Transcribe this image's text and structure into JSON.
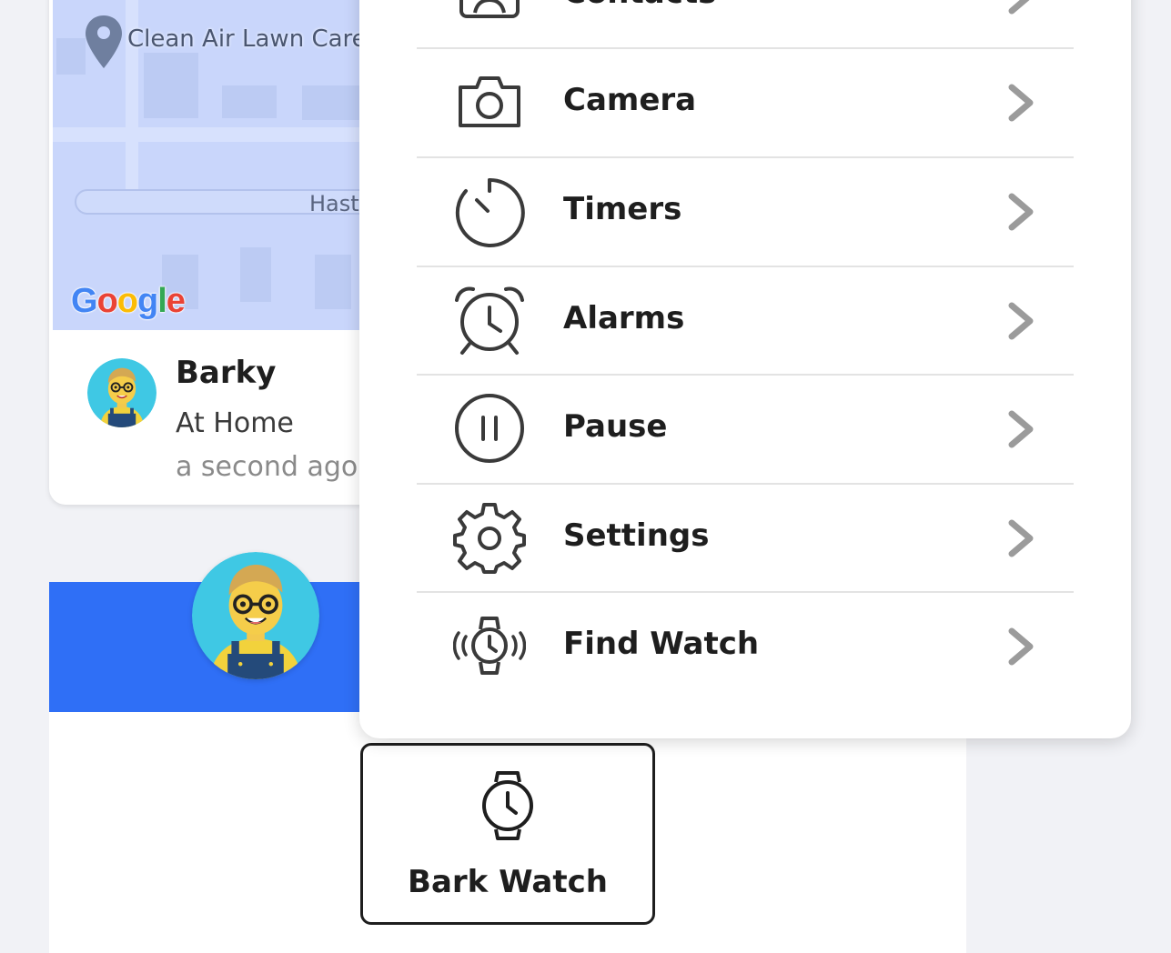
{
  "map": {
    "place_label": "Clean Air Lawn Care",
    "street_label": "Hastings",
    "attribution": "Google"
  },
  "profile": {
    "name": "Barky",
    "status": "At Home",
    "updated": "a second ago"
  },
  "menu": {
    "items": [
      {
        "label": "Contacts",
        "icon": "contacts-icon"
      },
      {
        "label": "Camera",
        "icon": "camera-icon"
      },
      {
        "label": "Timers",
        "icon": "timer-icon"
      },
      {
        "label": "Alarms",
        "icon": "alarm-clock-icon"
      },
      {
        "label": "Pause",
        "icon": "pause-icon"
      },
      {
        "label": "Settings",
        "icon": "gear-icon"
      },
      {
        "label": "Find Watch",
        "icon": "find-watch-icon"
      }
    ]
  },
  "device_tile": {
    "label": "Bark Watch",
    "icon": "watch-icon"
  },
  "colors": {
    "accent_blue": "#2f6ff6",
    "map_bg": "#c9d6fb",
    "chevron": "#9b9b9b",
    "avatar_bg": "#3fc8e4"
  }
}
